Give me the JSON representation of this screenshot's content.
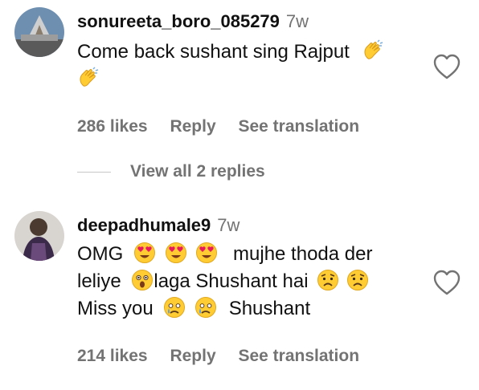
{
  "comments": [
    {
      "username": "sonureeta_boro_085279",
      "time": "7w",
      "text_1": "Come back sushant sing Rajput",
      "likes": "286 likes",
      "reply": "Reply",
      "translate": "See translation",
      "icons": [
        "clapping-hands-icon",
        "clapping-hands-icon",
        "heart-outline-icon"
      ]
    },
    {
      "username": "deepadhumale9",
      "time": "7w",
      "text_1": "OMG",
      "text_2": "mujhe thoda der",
      "text_3": "leliye",
      "text_4": "laga Shushant hai",
      "text_5": "Miss you",
      "text_6": "Shushant",
      "likes": "214 likes",
      "reply": "Reply",
      "translate": "See translation",
      "icons": [
        "heart-eyes-icon",
        "astonished-face-icon",
        "worried-face-icon",
        "sad-tear-face-icon",
        "heart-outline-icon"
      ]
    }
  ],
  "view_replies": "View all 2 replies",
  "colors": {
    "text": "#111111",
    "muted": "#737373",
    "divider": "#c7c7c7",
    "emoji": "#ffcc33"
  }
}
